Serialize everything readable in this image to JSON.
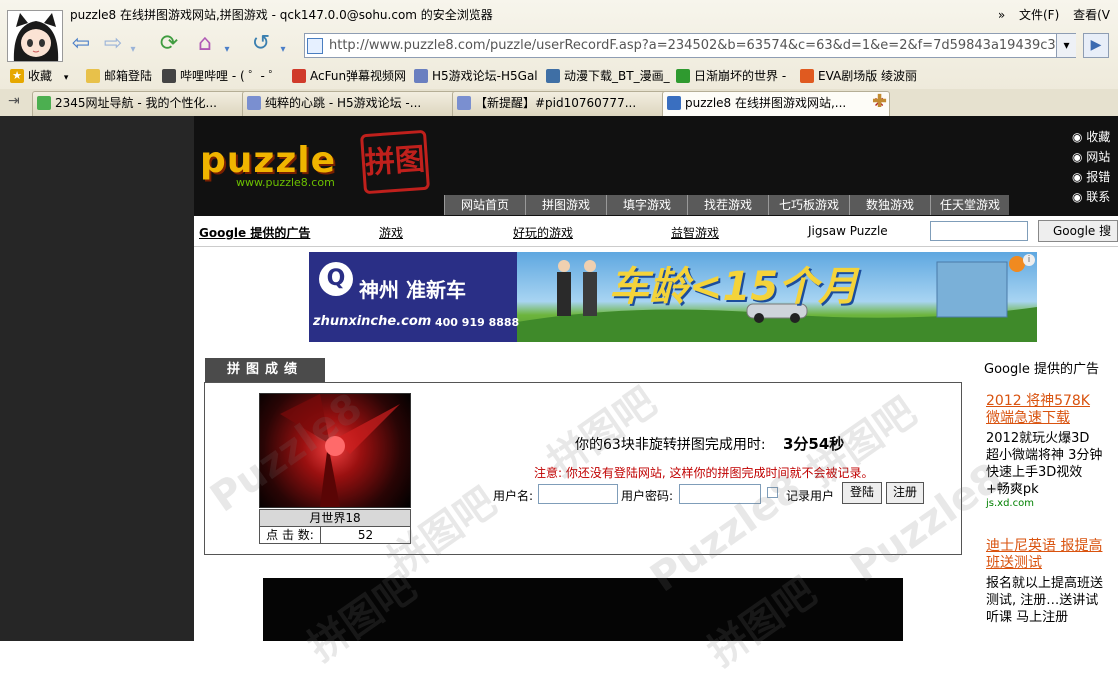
{
  "browser": {
    "window_title": "puzzle8 在线拼图游戏网站,拼图游戏 - qck147.0.0@sohu.com 的安全浏览器",
    "menu": [
      "文件(F)",
      "查看(V"
    ],
    "menu_chevron": "»",
    "address": "http://www.puzzle8.com/puzzle/userRecordF.asp?a=234502&b=63574&c=63&d=1&e=2&f=7d59843a19439c3f8n",
    "favorites": [
      {
        "label": "收藏",
        "color": "#e6a800"
      },
      {
        "label": "邮箱登陆",
        "color": "#e8c14a"
      },
      {
        "label": "哔哩哔哩 - ( ゜- ゜",
        "color": "#444444"
      },
      {
        "label": "AcFun弹幕视频网",
        "color": "#d03a2a"
      },
      {
        "label": "H5游戏论坛-H5Gal",
        "color": "#6a7fc0"
      },
      {
        "label": "动漫下载_BT_漫画_",
        "color": "#3f6fa5"
      },
      {
        "label": "日渐崩坏的世界 - ",
        "color": "#2f9a2f"
      },
      {
        "label": "EVA剧场版 绫波丽",
        "color": "#e05a20"
      }
    ],
    "tabs": [
      {
        "label": "2345网址导航 - 我的个性化...",
        "color": "#4caf50"
      },
      {
        "label": "纯粹的心跳 - H5游戏论坛 -...",
        "color": "#7a8fd0"
      },
      {
        "label": "【新提醒】#pid10760777...",
        "color": "#7a8fd0"
      },
      {
        "label": "puzzle8 在线拼图游戏网站,...",
        "color": "#3a6fc0"
      }
    ],
    "new_tab_icon": "✚"
  },
  "site": {
    "logo_text": "puzzle",
    "logo_cn": "拼图",
    "logo_url": "www.puzzle8.com",
    "nav": [
      "网站首页",
      "拼图游戏",
      "填字游戏",
      "找茬游戏",
      "七巧板游戏",
      "数独游戏",
      "任天堂游戏"
    ],
    "top_links": [
      "收藏",
      "网站",
      "报错",
      "联系"
    ],
    "ad_bar": {
      "label": "Google 提供的广告",
      "links": [
        "游戏",
        "好玩的游戏",
        "益智游戏",
        "Jigsaw Puzzle"
      ],
      "button": "Google 搜"
    }
  },
  "banner": {
    "brand": "神州",
    "brand2": "准新车",
    "site": "zhunxinche.com",
    "phone": "400 919 8888",
    "slogan": "车龄<15个月",
    "info_icon": "i"
  },
  "record": {
    "tab_title": "拼图成绩",
    "puzzle_name": "月世界18",
    "hits_label": "点 击 数:",
    "hits_value": "52",
    "finish_text": "你的63块非旋转拼图完成用时:",
    "finish_time": "3分54秒",
    "notice": "注意: 你还没有登陆网站, 这样你的拼图完成时间就不会被记录。",
    "username_label": "用户名:",
    "password_label": "用户密码:",
    "remember_label": "记录用户",
    "login_button": "登陆",
    "register_button": "注册"
  },
  "side_ads": {
    "header": "Google 提供的广告",
    "ads": [
      {
        "title": "2012 将神578K 微端急速下载",
        "body": "2012就玩火爆3D 超小微端将神 3分钟快速上手3D视效+畅爽pk",
        "url": "js.xd.com"
      },
      {
        "title": "迪士尼英语 报提高班送测试",
        "body": "报名就以上提高班送测试, 注册…送讲试听课 马上注册"
      }
    ]
  },
  "watermark": [
    "Puzzle8",
    "拼图吧"
  ]
}
